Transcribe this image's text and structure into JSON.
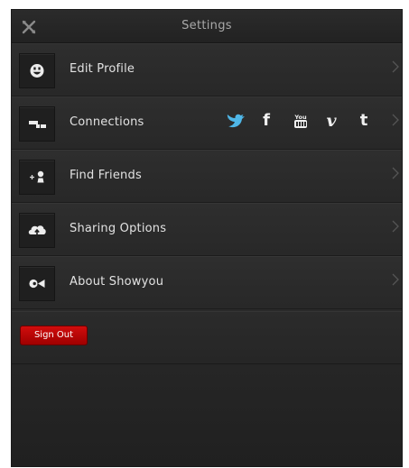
{
  "header": {
    "title": "Settings",
    "close_icon": "close-x-icon"
  },
  "rows": [
    {
      "label": "Edit Profile",
      "icon": "smiley-icon"
    },
    {
      "label": "Connections",
      "icon": "connections-icon"
    },
    {
      "label": "Find Friends",
      "icon": "add-person-icon"
    },
    {
      "label": "Sharing Options",
      "icon": "cloud-upload-icon"
    },
    {
      "label": "About Showyou",
      "icon": "showyou-logo-icon"
    }
  ],
  "connections": {
    "services": [
      "twitter",
      "facebook",
      "youtube",
      "vimeo",
      "tumblr"
    ],
    "facebook_glyph": "f",
    "vimeo_glyph": "v",
    "tumblr_glyph": "t",
    "youtube_glyph": "You"
  },
  "sign_out": {
    "label": "Sign Out"
  },
  "colors": {
    "panel_bg": "#2a2a2a",
    "row_text": "#e2e2e2",
    "header_text": "#a9a9a9",
    "sign_out_red": "#c00000",
    "chevron": "#555555"
  }
}
